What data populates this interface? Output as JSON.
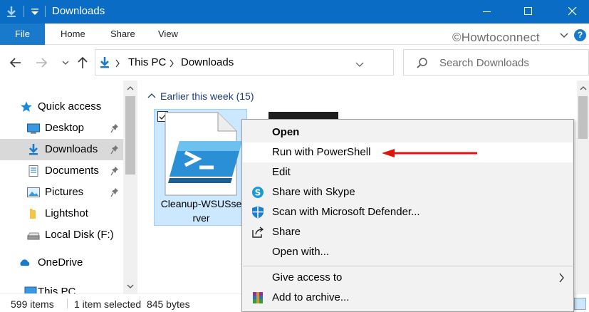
{
  "window": {
    "title": "Downloads"
  },
  "ribbon": {
    "file": "File",
    "tabs": [
      "Home",
      "Share",
      "View"
    ],
    "watermark": "©Howtoconnect"
  },
  "address": {
    "crumbs": [
      "This PC",
      "Downloads"
    ]
  },
  "search": {
    "placeholder": "Search Downloads"
  },
  "navpane": {
    "items": [
      {
        "label": "Quick access",
        "icon": "star-icon"
      },
      {
        "label": "Desktop",
        "icon": "desktop-icon",
        "pinned": true
      },
      {
        "label": "Downloads",
        "icon": "download-arrow-icon",
        "pinned": true,
        "selected": true
      },
      {
        "label": "Documents",
        "icon": "document-icon",
        "pinned": true
      },
      {
        "label": "Pictures",
        "icon": "picture-icon",
        "pinned": true
      },
      {
        "label": "Lightshot",
        "icon": "folder-icon"
      },
      {
        "label": "Local Disk (F:)",
        "icon": "drive-icon"
      },
      {
        "label": "OneDrive",
        "icon": "cloud-icon"
      },
      {
        "label": "This PC",
        "icon": "computer-icon"
      }
    ]
  },
  "content": {
    "group_header": "Earlier this week (15)",
    "selected_file": {
      "name": "Cleanup-WSUSserver",
      "name_line1": "Cleanup-WSUSse",
      "name_line2": "rver"
    }
  },
  "context_menu": {
    "items": [
      {
        "label": "Open",
        "bold": true
      },
      {
        "label": "Run with PowerShell",
        "highlighted": true
      },
      {
        "label": "Edit"
      },
      {
        "label": "Share with Skype",
        "icon": "skype-icon"
      },
      {
        "label": "Scan with Microsoft Defender...",
        "icon": "defender-shield-icon"
      },
      {
        "label": "Share",
        "icon": "share-icon"
      },
      {
        "label": "Open with..."
      },
      {
        "label": "Give access to",
        "submenu": true
      },
      {
        "label": "Add to archive...",
        "icon": "winrar-icon"
      }
    ]
  },
  "status": {
    "count": "599 items",
    "selection": "1 item selected  845 bytes"
  },
  "colors": {
    "titlebar": "#0a6cc4",
    "accent": "#1979ca",
    "annotation_arrow": "#e3120b",
    "selection": "#cce8ff"
  }
}
